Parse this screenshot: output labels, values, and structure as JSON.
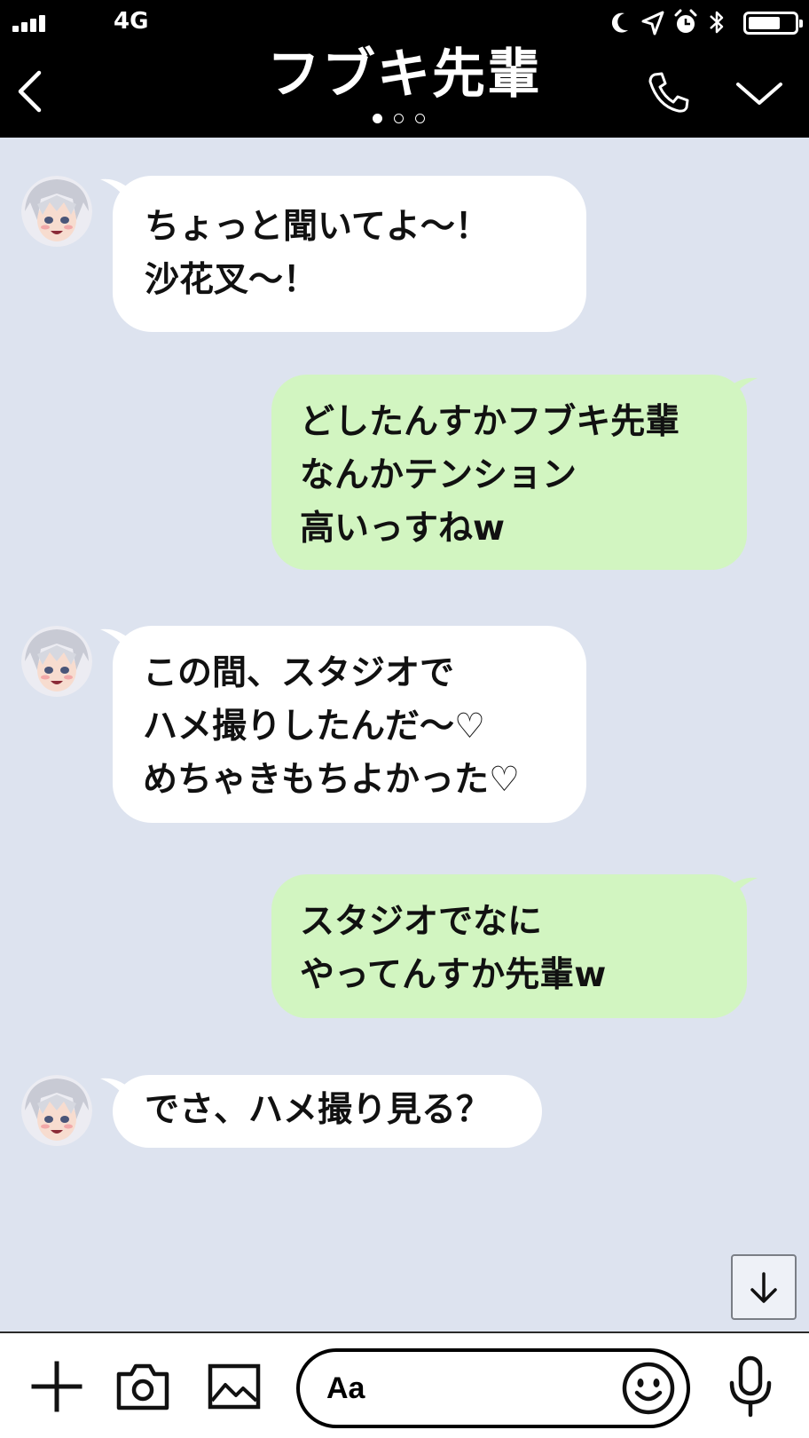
{
  "status_bar": {
    "network": "4G",
    "signal_bars": 4,
    "battery_level": 0.7,
    "icons": [
      "moon-icon",
      "location-arrow-icon",
      "alarm-clock-icon",
      "bluetooth-icon",
      "battery-icon"
    ]
  },
  "header": {
    "title": "フブキ先輩",
    "back_icon": "chevron-left-icon",
    "call_icon": "phone-icon",
    "menu_icon": "chevron-down-icon",
    "page_dots": 3,
    "active_dot": 0
  },
  "messages": [
    {
      "side": "received",
      "lines": [
        "ちょっと聞いてよ～！",
        "沙花叉～！"
      ]
    },
    {
      "side": "sent",
      "lines": [
        "どしたんすかフブキ先輩",
        "なんかテンション",
        "高いっすねw"
      ]
    },
    {
      "side": "received",
      "lines": [
        "この間、スタジオで",
        "ハメ撮りしたんだ～♡",
        "めちゃきもちよかった♡"
      ]
    },
    {
      "side": "sent",
      "lines": [
        "スタジオでなに",
        "やってんすか先輩w"
      ]
    },
    {
      "side": "received",
      "lines": [
        "でさ、ハメ撮り見る？"
      ]
    }
  ],
  "scroll_button": {
    "icon": "arrow-down-icon"
  },
  "input_bar": {
    "placeholder": "Aa",
    "left_icons": [
      "plus-icon",
      "camera-icon",
      "image-icon"
    ],
    "emoji_icon": "smiley-icon",
    "mic_icon": "microphone-icon"
  },
  "colors": {
    "header_bg": "#000000",
    "chat_bg": "#dde3ef",
    "received_bubble": "#ffffff",
    "sent_bubble": "#d2f5c1",
    "text": "#111111"
  }
}
